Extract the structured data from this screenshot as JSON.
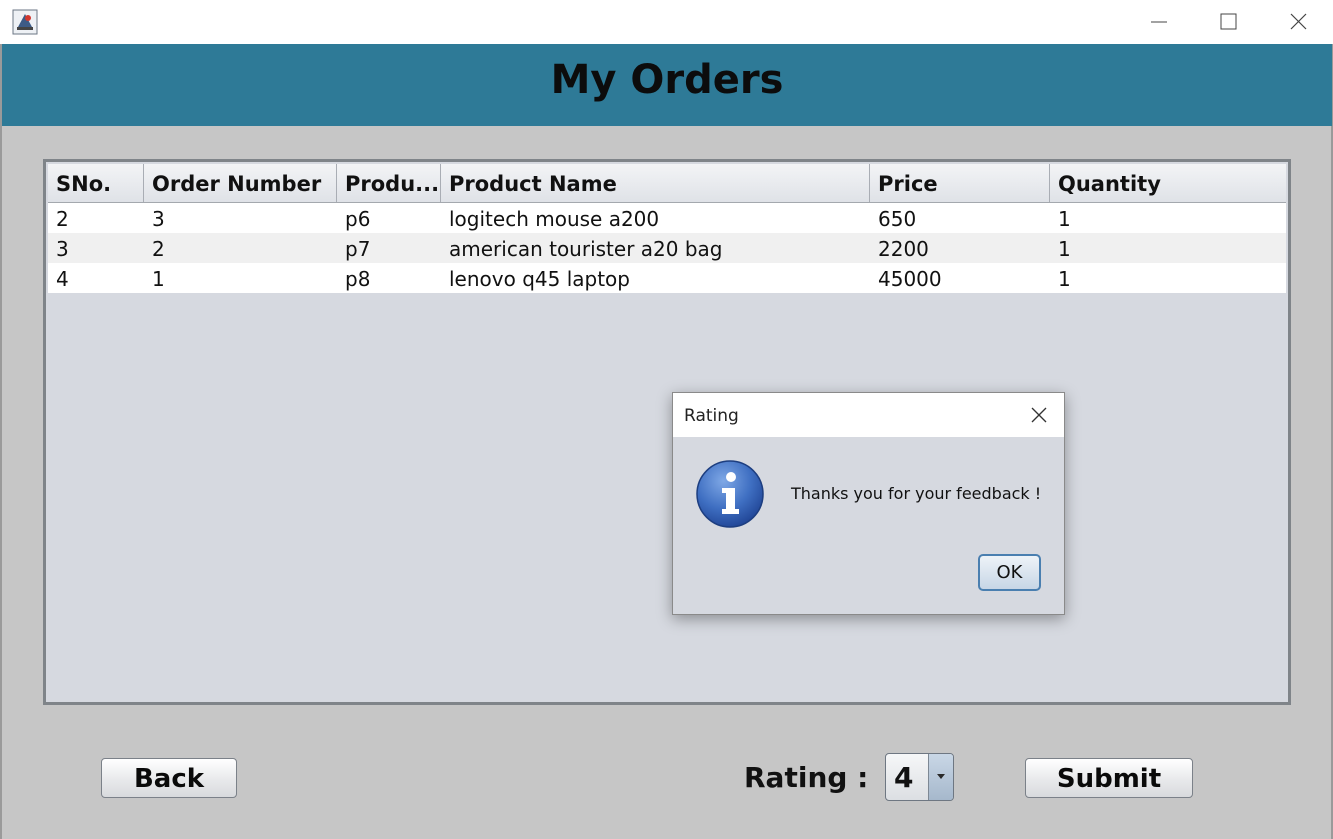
{
  "window": {
    "app_icon": "java-app-icon",
    "controls": [
      "minimize-icon",
      "maximize-icon",
      "close-icon"
    ]
  },
  "header": {
    "title": "My Orders",
    "background": "#2e7a97"
  },
  "table": {
    "columns": [
      "SNo.",
      "Order Number",
      "Produ...",
      "Product Name",
      "Price",
      "Quantity"
    ],
    "rows": [
      [
        "2",
        "3",
        "p6",
        "logitech mouse a200",
        "650",
        "1"
      ],
      [
        "3",
        "2",
        "p7",
        "american tourister a20 bag",
        "2200",
        "1"
      ],
      [
        "4",
        "1",
        "p8",
        "lenovo q45 laptop",
        "45000",
        "1"
      ]
    ]
  },
  "footer": {
    "back_label": "Back",
    "rating_label": "Rating :",
    "rating_value": "4",
    "submit_label": "Submit"
  },
  "dialog": {
    "title": "Rating",
    "icon": "info-icon",
    "message": "Thanks you for your feedback !",
    "ok_label": "OK"
  }
}
